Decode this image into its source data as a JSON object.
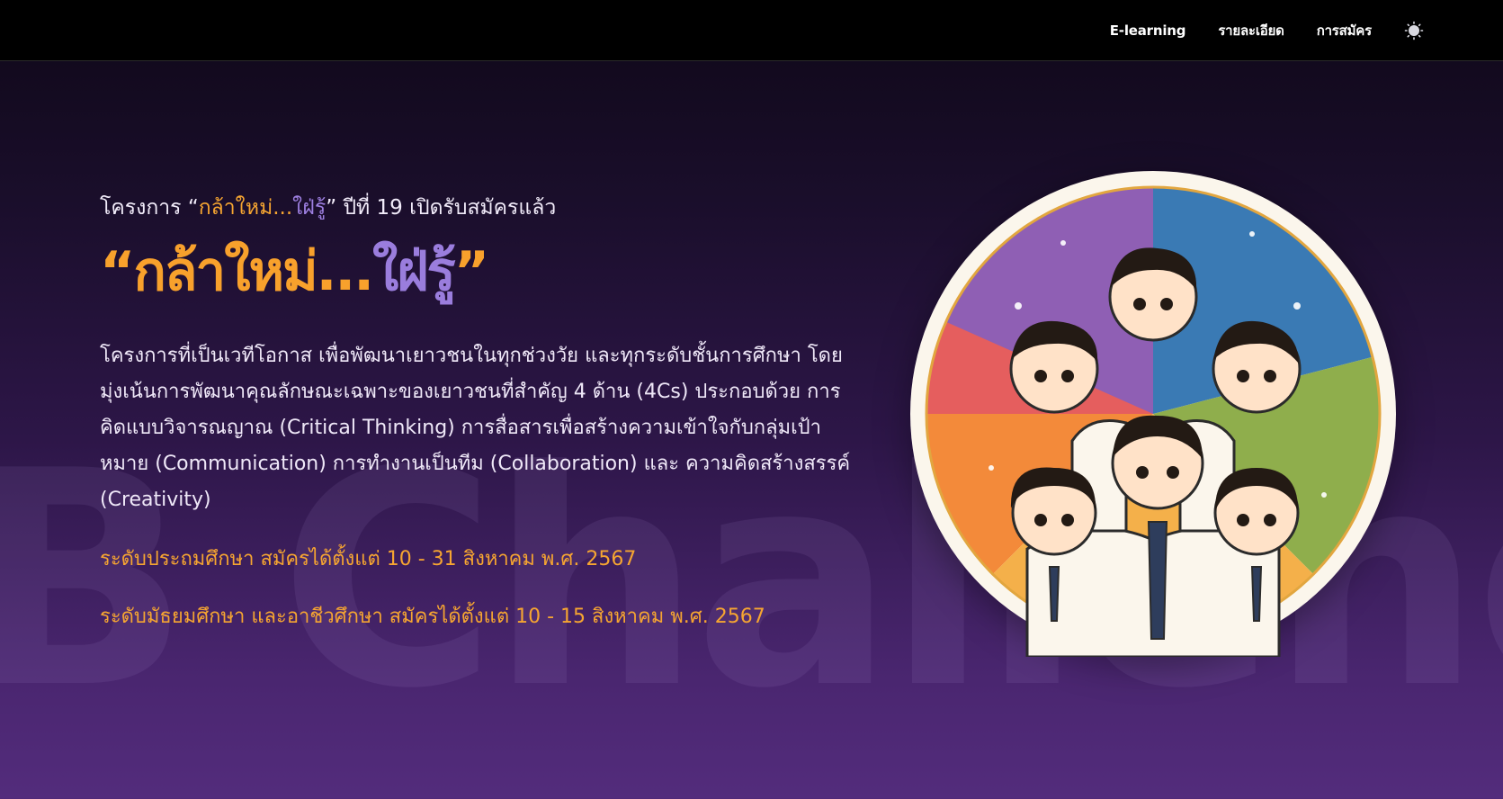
{
  "nav": {
    "links": [
      "E-learning",
      "รายละเอียด",
      "การสมัคร"
    ],
    "theme_toggle_icon": "sun-icon"
  },
  "watermark": "B Challeng",
  "hero": {
    "subtitle_prefix": "โครงการ “",
    "subtitle_hl_orange": "กล้าใหม่...",
    "subtitle_hl_purple": "ใฝ่รู้",
    "subtitle_suffix": "” ปีที่ 19 เปิดรับสมัครแล้ว",
    "title_open_quote": "“",
    "title_orange": "กล้าใหม่...",
    "title_purple": "ใฝ่รู้",
    "title_close_quote": "”",
    "description": "โครงการที่เป็นเวทีโอกาส เพื่อพัฒนาเยาวชนในทุกช่วงวัย และทุกระดับชั้นการศึกษา โดยมุ่งเน้นการพัฒนาคุณลักษณะเฉพาะของเยาวชนที่สำคัญ 4 ด้าน (4Cs) ประกอบด้วย การคิดแบบวิจารณญาณ (Critical Thinking) การสื่อสารเพื่อสร้างความเข้าใจกับกลุ่มเป้าหมาย (Communication) การทำงานเป็นทีม (Collaboration) และ ความคิดสร้างสรรค์ (Creativity)",
    "deadline_primary": "ระดับประถมศึกษา สมัครได้ตั้งแต่ 10 - 31 สิงหาคม พ.ศ. 2567",
    "deadline_secondary": "ระดับมัธยมศึกษา และอาชีวศึกษา สมัครได้ตั้งแต่ 10 - 15 สิงหาคม พ.ศ. 2567"
  },
  "colors": {
    "accent_orange": "#f6a531",
    "accent_purple": "#9a7ddd",
    "topbar": "#000000"
  }
}
